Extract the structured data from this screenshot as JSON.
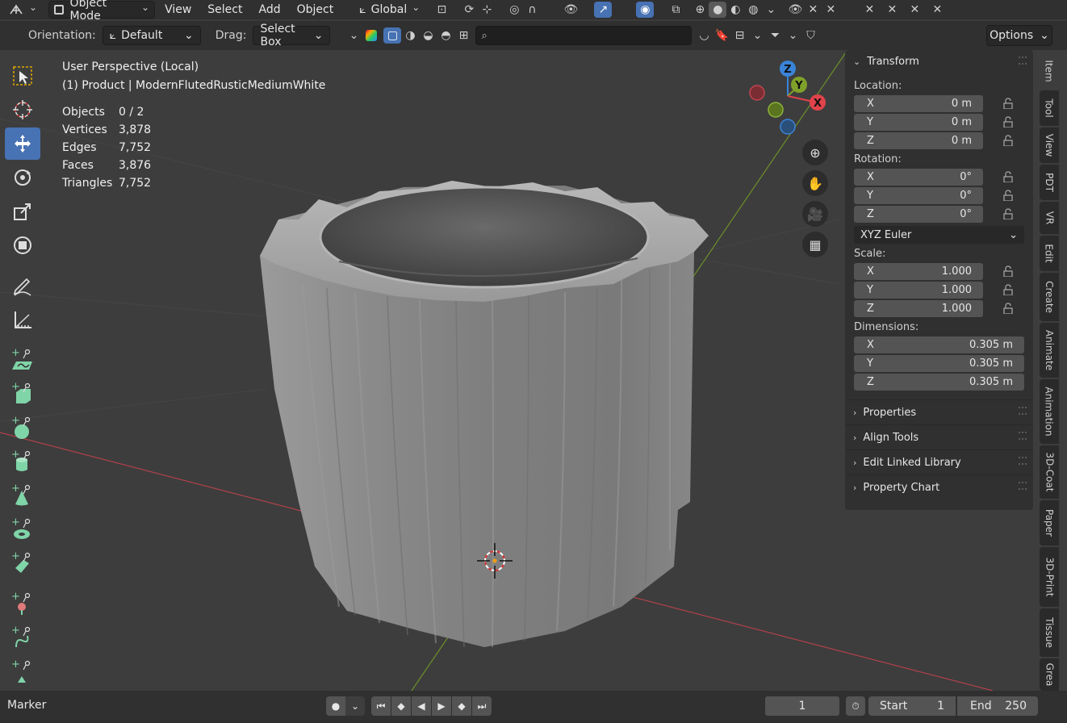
{
  "header": {
    "mode": "Object Mode",
    "menus": [
      "View",
      "Select",
      "Add",
      "Object"
    ],
    "transform_orientation": "Global"
  },
  "tool_header": {
    "orientation_label": "Orientation:",
    "orientation_value": "Default",
    "drag_label": "Drag:",
    "drag_value": "Select Box",
    "search_placeholder": "",
    "options_label": "Options"
  },
  "viewport": {
    "view_name": "User Perspective (Local)",
    "object_label": "(1) Product | ModernFlutedRusticMediumWhite",
    "stats": [
      {
        "key": "Objects",
        "value": "0 / 2"
      },
      {
        "key": "Vertices",
        "value": "3,878"
      },
      {
        "key": "Edges",
        "value": "7,752"
      },
      {
        "key": "Faces",
        "value": "3,876"
      },
      {
        "key": "Triangles",
        "value": "7,752"
      }
    ],
    "gizmo": {
      "x": "X",
      "y": "Y",
      "z": "Z",
      "x_color": "#e0434b",
      "y_color": "#7fa12a",
      "z_color": "#3a84d8"
    }
  },
  "npanel": {
    "transform_title": "Transform",
    "location_label": "Location:",
    "location": [
      {
        "axis": "X",
        "value": "0 m"
      },
      {
        "axis": "Y",
        "value": "0 m"
      },
      {
        "axis": "Z",
        "value": "0 m"
      }
    ],
    "rotation_label": "Rotation:",
    "rotation": [
      {
        "axis": "X",
        "value": "0°"
      },
      {
        "axis": "Y",
        "value": "0°"
      },
      {
        "axis": "Z",
        "value": "0°"
      }
    ],
    "rotation_mode": "XYZ Euler",
    "scale_label": "Scale:",
    "scale": [
      {
        "axis": "X",
        "value": "1.000"
      },
      {
        "axis": "Y",
        "value": "1.000"
      },
      {
        "axis": "Z",
        "value": "1.000"
      }
    ],
    "dimensions_label": "Dimensions:",
    "dimensions": [
      {
        "axis": "X",
        "value": "0.305 m"
      },
      {
        "axis": "Y",
        "value": "0.305 m"
      },
      {
        "axis": "Z",
        "value": "0.305 m"
      }
    ],
    "collapsed_panels": [
      "Properties",
      "Align Tools",
      "Edit Linked Library",
      "Property Chart"
    ]
  },
  "side_tabs": [
    "Item",
    "Tool",
    "View",
    "PDT",
    "VR",
    "Edit",
    "Create",
    "Animate",
    "Animation",
    "3D-Coat",
    "Paper",
    "3D-Print",
    "Tissue",
    "Grea"
  ],
  "timeline": {
    "marker_label": "Marker",
    "current_frame": "1",
    "start_label": "Start",
    "start_value": "1",
    "end_label": "End",
    "end_value": "250"
  },
  "colors": {
    "accent": "#4772b3",
    "add_tool_green": "#7fd4a8",
    "mesh": "#8e8e8e"
  }
}
